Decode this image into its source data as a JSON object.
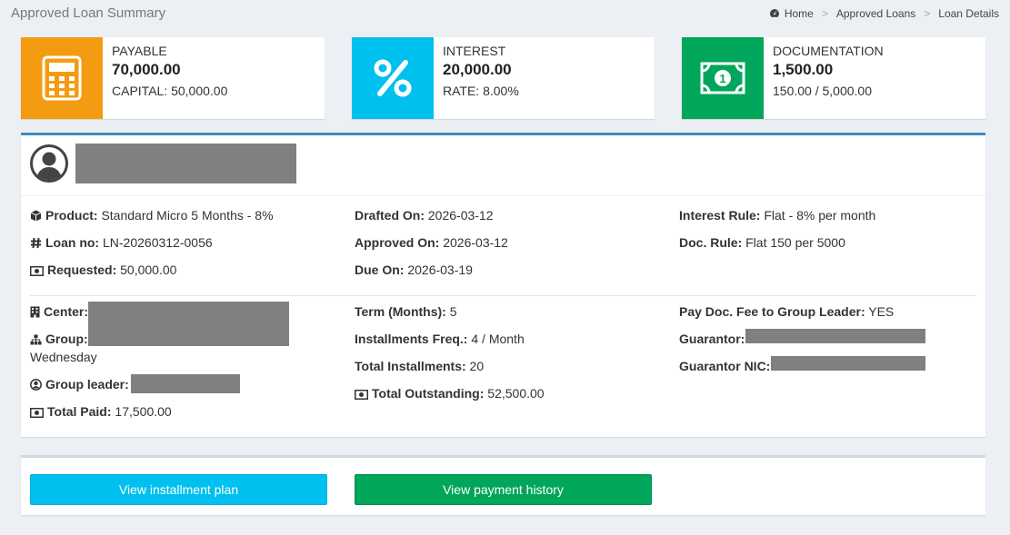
{
  "page": {
    "title": "Approved Loan Summary"
  },
  "breadcrumb": {
    "home": "Home",
    "approved_loans": "Approved Loans",
    "current": "Loan Details"
  },
  "colors": {
    "payable": "#f39c12",
    "interest": "#00c0ef",
    "documentation": "#00a65a",
    "panel_accent": "#3c8dbc"
  },
  "boxes": {
    "payable": {
      "icon": "calculator-icon",
      "label": "PAYABLE",
      "value": "70,000.00",
      "sub": "CAPITAL: 50,000.00"
    },
    "interest": {
      "icon": "percent-icon",
      "label": "INTEREST",
      "value": "20,000.00",
      "sub": "RATE: 8.00%"
    },
    "documentation": {
      "icon": "money-bill-icon",
      "label": "DOCUMENTATION",
      "value": "1,500.00",
      "sub": "150.00 / 5,000.00"
    }
  },
  "loan": {
    "product_label": "Product:",
    "product": "Standard Micro 5 Months - 8%",
    "loan_no_label": "Loan no:",
    "loan_no": "LN-20260312-0056",
    "requested_label": "Requested:",
    "requested": "50,000.00",
    "drafted_label": "Drafted On:",
    "drafted": "2026-03-12",
    "approved_label": "Approved On:",
    "approved": "2026-03-12",
    "due_label": "Due On:",
    "due": "2026-03-19",
    "interest_rule_label": "Interest Rule:",
    "interest_rule": "Flat - 8% per month",
    "doc_rule_label": "Doc. Rule:",
    "doc_rule": "Flat 150 per 5000",
    "center_label": "Center:",
    "group_label": "Group:",
    "group_day": "Wednesday",
    "group_leader_label": "Group leader:",
    "total_paid_label": "Total Paid:",
    "total_paid": "17,500.00",
    "term_label": "Term (Months):",
    "term": "5",
    "freq_label": "Installments Freq.:",
    "freq": "4 / Month",
    "total_inst_label": "Total Installments:",
    "total_inst": "20",
    "outstanding_label": "Total Outstanding:",
    "outstanding": "52,500.00",
    "pay_doc_label": "Pay Doc. Fee to Group Leader:",
    "pay_doc": "YES",
    "guarantor_label": "Guarantor:",
    "guarantor_nic_label": "Guarantor NIC:"
  },
  "actions": {
    "installment_plan": "View installment plan",
    "payment_history": "View payment history"
  }
}
